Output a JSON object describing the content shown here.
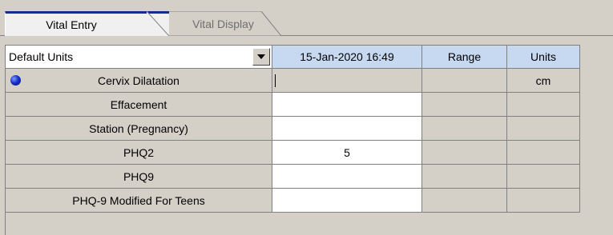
{
  "tabs": [
    {
      "label": "Vital Entry",
      "active": true
    },
    {
      "label": "Vital Display",
      "active": false
    }
  ],
  "header": {
    "units_dropdown": "Default Units",
    "datetime": "15-Jan-2020 16:49",
    "range": "Range",
    "units": "Units"
  },
  "rows": [
    {
      "label": "Cervix Dilatation",
      "value": "",
      "range": "",
      "units": "cm",
      "selected": true,
      "icon": "blue-dot-icon"
    },
    {
      "label": "Effacement",
      "value": "",
      "range": "",
      "units": ""
    },
    {
      "label": "Station (Pregnancy)",
      "value": "",
      "range": "",
      "units": ""
    },
    {
      "label": "PHQ2",
      "value": "5",
      "range": "",
      "units": ""
    },
    {
      "label": "PHQ9",
      "value": "",
      "range": "",
      "units": ""
    },
    {
      "label": "PHQ-9 Modified For Teens",
      "value": "",
      "range": "",
      "units": ""
    }
  ],
  "colors": {
    "header_blue": "#c6d9f1",
    "tab_accent": "#102f8a",
    "grid_grey": "#d4d0c8"
  }
}
